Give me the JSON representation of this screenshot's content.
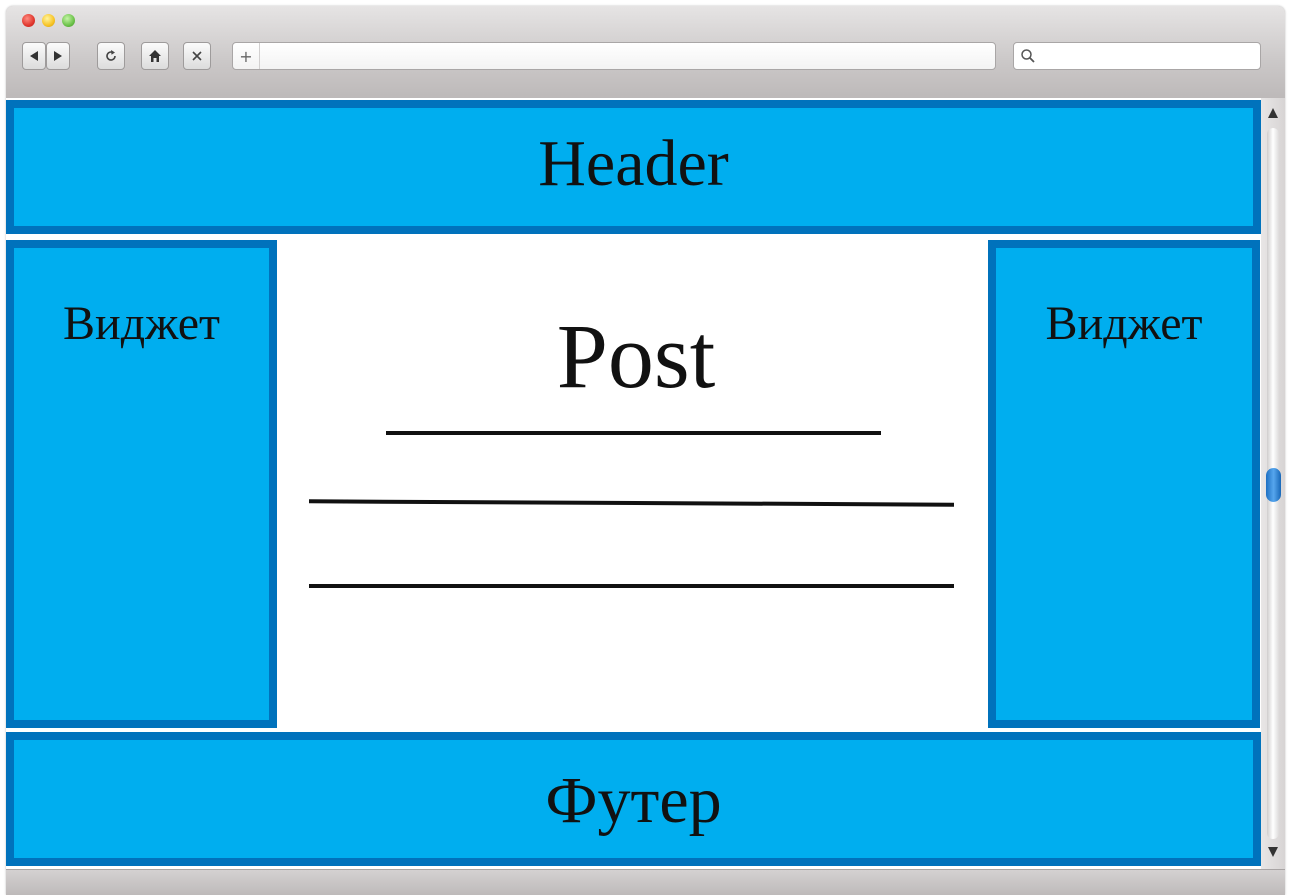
{
  "browser": {
    "toolbar": {
      "back_icon": "back-arrow-icon",
      "forward_icon": "forward-arrow-icon",
      "reload_icon": "reload-icon",
      "home_icon": "home-icon",
      "stop_icon": "close-icon",
      "new_tab_label": "+"
    },
    "address_bar": {
      "value": ""
    },
    "search_bar": {
      "value": "",
      "icon": "search-icon"
    }
  },
  "page": {
    "header": {
      "label": "Header"
    },
    "left_widget": {
      "label": "Виджет"
    },
    "right_widget": {
      "label": "Виджет"
    },
    "post": {
      "title": "Post"
    },
    "footer": {
      "label": "Футер"
    }
  },
  "colors": {
    "box_fill": "#00aeef",
    "box_border": "#0072bc",
    "scroll_thumb": "#2a86d8"
  }
}
